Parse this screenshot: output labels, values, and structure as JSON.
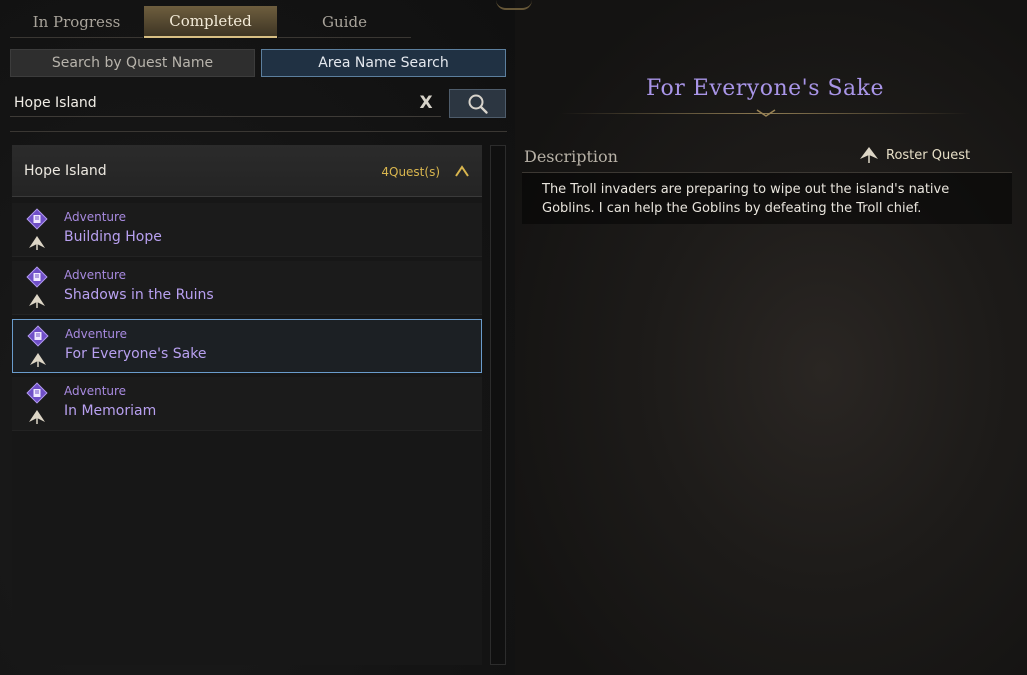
{
  "tabs": [
    {
      "label": "In Progress",
      "active": false
    },
    {
      "label": "Completed",
      "active": true
    },
    {
      "label": "Guide",
      "active": false
    }
  ],
  "search_modes": {
    "by_name": "Search by Quest Name",
    "by_area": "Area Name Search",
    "active": "by_area"
  },
  "search": {
    "value": "Hope Island",
    "clear_label": "X"
  },
  "area": {
    "name": "Hope Island",
    "count": "4Quest(s)"
  },
  "quests": [
    {
      "type": "Adventure",
      "name": "Building Hope",
      "selected": false
    },
    {
      "type": "Adventure",
      "name": "Shadows in the Ruins",
      "selected": false
    },
    {
      "type": "Adventure",
      "name": "For Everyone's Sake",
      "selected": true
    },
    {
      "type": "Adventure",
      "name": "In Memoriam",
      "selected": false
    }
  ],
  "detail": {
    "title": "For Everyone's Sake",
    "description_label": "Description",
    "roster_label": "Roster Quest",
    "description": "The Troll invaders are preparing to wipe out the island's native Goblins. I can help the Goblins by defeating the Troll chief."
  },
  "colors": {
    "quest_name": "#b8a0f0",
    "quest_type": "#a88ae0",
    "count": "#d9b64e",
    "active_tab": "#d8bf84",
    "selected_border": "#6a9ccc"
  },
  "icons": {
    "quest_type": "adventure-book-icon",
    "roster": "roster-quest-icon",
    "search": "magnifier-icon",
    "collapse": "chevron-up-icon"
  }
}
